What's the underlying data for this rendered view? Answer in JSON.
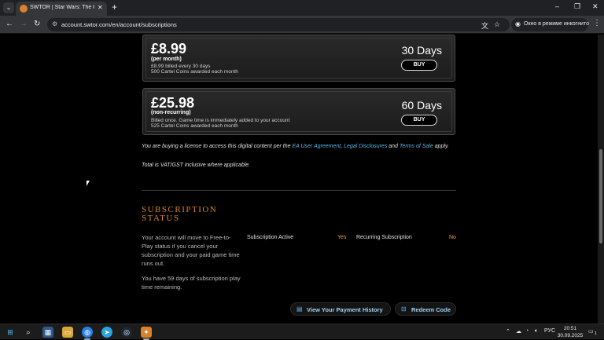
{
  "browser": {
    "tab_title": "SWTOR | Star Wars: The Old Re",
    "tab_close": "✕",
    "new_tab": "+",
    "url": "account.swtor.com/en/account/subscriptions",
    "incognito_label": "Окно в режиме инкогнито",
    "window_controls": {
      "minimize": "–",
      "restore": "❐",
      "close": "✕"
    }
  },
  "plans": [
    {
      "price": "£8.99",
      "period": "(per month)",
      "details": [
        "£8.99 billed every 30 days",
        "500 Cartel Coins awarded each month"
      ],
      "days": "30 Days",
      "buy_label": "BUY"
    },
    {
      "price": "£25.98",
      "period": "(non-recurring)",
      "details": [
        "Billed once. Game time is immediately added to your account",
        "525 Cartel Coins awarded each month"
      ],
      "days": "60 Days",
      "buy_label": "BUY"
    }
  ],
  "license": {
    "prefix": "You are buying a license to access this digital content per the ",
    "link1": "EA User Agreement",
    "sep": ", ",
    "link2": "Legal Disclosures",
    "and": " and ",
    "link3": "Terms of Sale",
    "suffix": " apply."
  },
  "vat_note": "Total is VAT/GST inclusive where applicable.",
  "subscription_status": {
    "title": "SUBSCRIPTION STATUS",
    "note": "Your account will move to Free-to-Play status if you cancel your subscription and your paid game time runs out.",
    "remaining": "You have 59 days of subscription play time remaining.",
    "active_label": "Subscription Active",
    "active_value": "Yes",
    "recurring_label": "Recurring Subscription",
    "recurring_value": "No"
  },
  "actions": {
    "payment_history": "View Your Payment History",
    "redeem_code": "Redeem Code"
  },
  "taskbar": {
    "lang": "РУС",
    "time": "20:51",
    "date": "30.09.2025",
    "notifications": "1"
  }
}
